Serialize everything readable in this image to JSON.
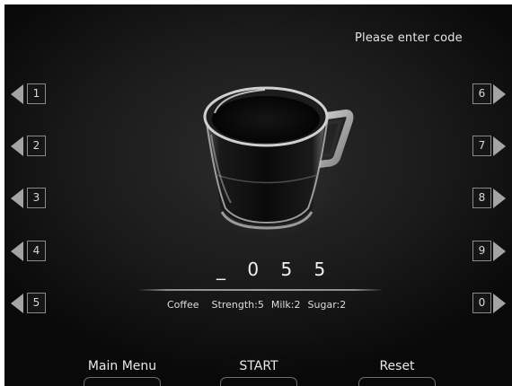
{
  "prompt": "Please enter code",
  "left_keys": [
    "1",
    "2",
    "3",
    "4",
    "5"
  ],
  "right_keys": [
    "6",
    "7",
    "8",
    "9",
    "0"
  ],
  "code_display": "_ 0 5 5",
  "summary": {
    "drink": "Coffee",
    "strength": "Strength:5",
    "milk": "Milk:2",
    "sugar": "Sugar:2"
  },
  "bottom_buttons": {
    "main_menu": "Main Menu",
    "start": "START",
    "reset": "Reset"
  },
  "icons": {
    "key_left_arrow": "triangle-left-icon",
    "key_right_arrow": "triangle-right-icon",
    "cup": "coffee-cup-icon"
  },
  "colors": {
    "background": "#1b1b1b",
    "text": "#e6e6e6",
    "arrow": "#a4a4a4",
    "key_border": "#8a8a8a"
  }
}
